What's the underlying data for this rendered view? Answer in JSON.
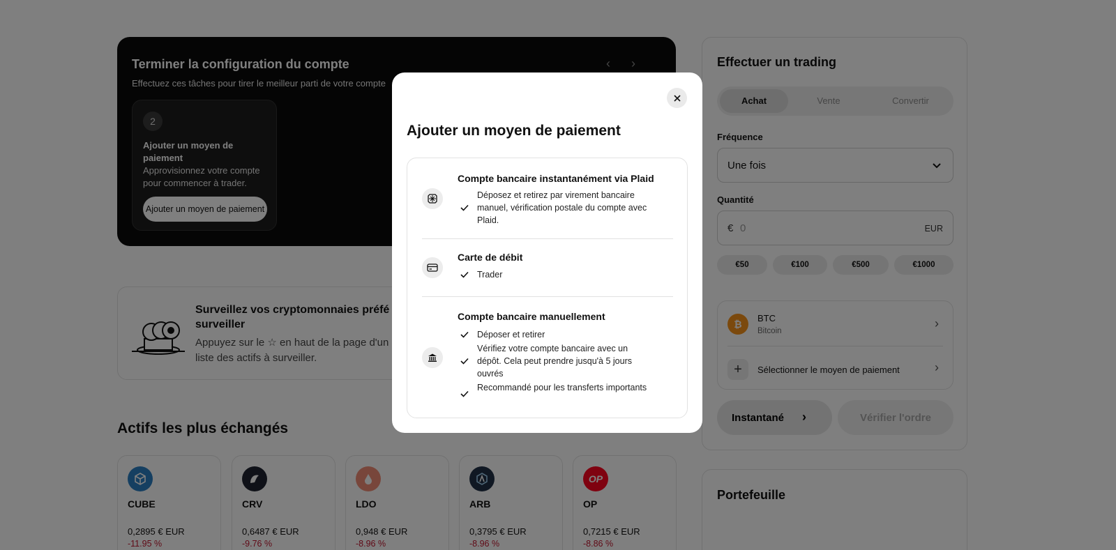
{
  "setup": {
    "title": "Terminer la configuration du compte",
    "subtitle": "Effectuez ces tâches pour tirer le meilleur parti de votre compte",
    "prev_icon": "chevron-left-icon",
    "next_icon": "chevron-right-icon",
    "task": {
      "number": "2",
      "title": "Ajouter un moyen de paiement",
      "description": "Approvisionnez votre compte pour commencer à trader.",
      "button": "Ajouter un moyen de paiement"
    }
  },
  "watchlist": {
    "title": "Surveillez vos cryptomonnaies préfé à surveiller",
    "description": "Appuyez sur le ☆ en haut de la page d'un liste des actifs à surveiller."
  },
  "most_traded": {
    "title": "Actifs les plus échangés",
    "assets": [
      {
        "symbol": "CUBE",
        "price": "0,2895 € EUR",
        "change": "-11.95 %",
        "color": "#2b7fc2"
      },
      {
        "symbol": "CRV",
        "price": "0,6487 € EUR",
        "change": "-9.76 %",
        "color": "#1f2330"
      },
      {
        "symbol": "LDO",
        "price": "0,948 € EUR",
        "change": "-8.96 %",
        "color": "#f08d76"
      },
      {
        "symbol": "ARB",
        "price": "0,3795 € EUR",
        "change": "-8.96 %",
        "color": "#213147"
      },
      {
        "symbol": "OP",
        "price": "0,7215 € EUR",
        "change": "-8.86 %",
        "color": "#ff0420",
        "icon_text": "OP"
      }
    ]
  },
  "trade": {
    "title": "Effectuer un trading",
    "tabs": [
      "Achat",
      "Vente",
      "Convertir"
    ],
    "active_tab": "Achat",
    "frequency_label": "Fréquence",
    "frequency_value": "Une fois",
    "quantity_label": "Quantité",
    "currency_symbol": "€",
    "quantity_placeholder": "0",
    "quantity_unit": "EUR",
    "presets": [
      "€50",
      "€100",
      "€500",
      "€1000"
    ],
    "asset_symbol": "BTC",
    "asset_name": "Bitcoin",
    "select_payment": "Sélectionner le moyen de paiement",
    "instant_button": "Instantané",
    "verify_button": "Vérifier l'ordre"
  },
  "portfolio": {
    "title": "Portefeuille"
  },
  "modal": {
    "title": "Ajouter un moyen de paiement",
    "close_icon": "close-icon",
    "options": [
      {
        "icon": "plaid-icon",
        "title": "Compte bancaire instantanément via Plaid",
        "features": [
          "Déposez et retirez par virement bancaire manuel, vérification postale du compte avec Plaid."
        ]
      },
      {
        "icon": "credit-card-icon",
        "title": "Carte de débit",
        "features": [
          "Trader"
        ]
      },
      {
        "icon": "bank-icon",
        "title": "Compte bancaire manuellement",
        "features": [
          "Déposer et retirer",
          "Vérifiez votre compte bancaire avec un dépôt. Cela peut prendre jusqu'à 5 jours ouvrés",
          "Recommandé pour les transferts importants"
        ]
      }
    ]
  }
}
